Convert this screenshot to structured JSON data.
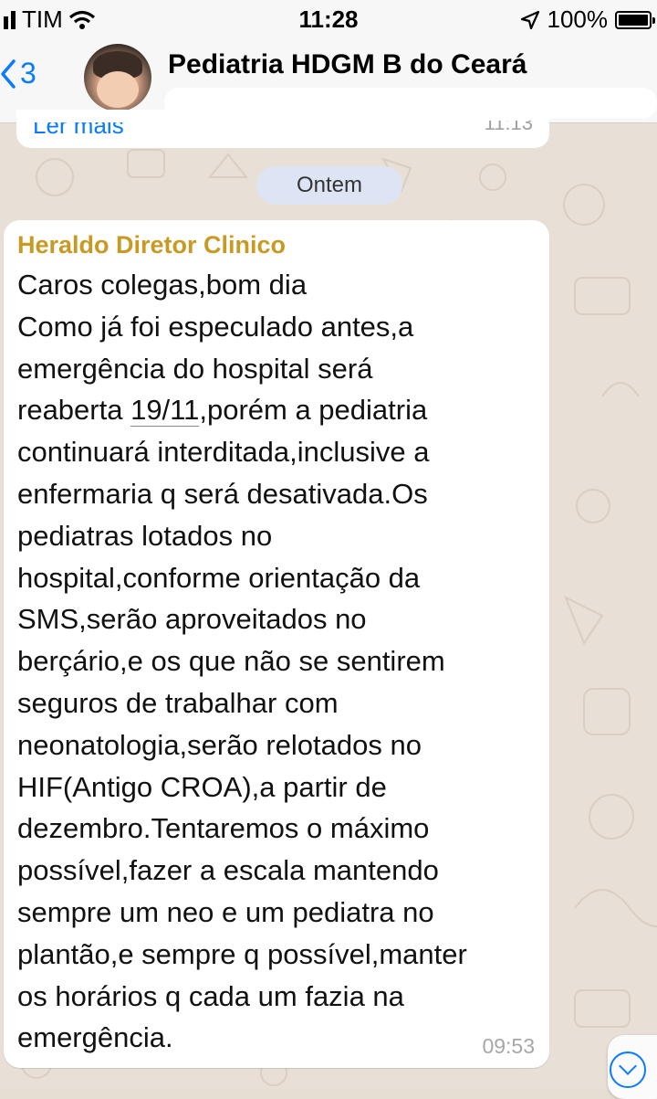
{
  "status_bar": {
    "carrier": "TIM",
    "time": "11:28",
    "battery": "100%"
  },
  "header": {
    "back_count": "3",
    "chat_title": "Pediatria HDGM B do Ceará"
  },
  "previous_message": {
    "link_text": "Ler mais",
    "time": "11:13"
  },
  "date_separator": "Ontem",
  "message": {
    "sender": "Heraldo Diretor Clinico",
    "lines": [
      "Caros colegas,bom dia",
      "Como já foi especulado antes,a",
      "emergência do hospital será",
      "reaberta ",
      "continuará interditada,inclusive a",
      "enfermaria q será desativada.Os",
      "pediatras lotados no",
      "hospital,conforme orientação da",
      "SMS,serão aproveitados no",
      "berçário,e os que não se sentirem",
      "seguros de trabalhar com",
      "neonatologia,serão relotados no",
      "HIF(Antigo CROA),a partir de",
      "dezembro.Tentaremos o máximo",
      "possível,fazer a escala mantendo",
      "sempre um neo e um pediatra no",
      "plantão,e sempre q possível,manter",
      "os horários q cada um fazia na",
      "emergência."
    ],
    "date_link": "19/11",
    "line4_rest": ",porém a pediatria",
    "time": "09:53"
  },
  "colors": {
    "accent": "#0a7aff",
    "sender": "#c89a23",
    "date_pill": "#dde4f3",
    "wallpaper": "#e8e0d6"
  },
  "icons": [
    "signal-icon",
    "wifi-icon",
    "location-arrow-icon",
    "battery-icon",
    "back-chevron-icon",
    "scroll-down-icon"
  ]
}
